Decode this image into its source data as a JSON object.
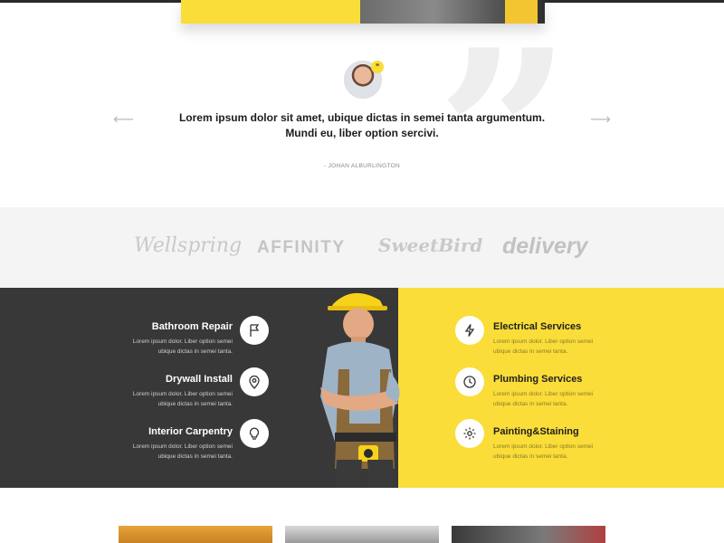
{
  "testimonial": {
    "quote": "Lorem ipsum dolor sit amet, ubique dictas in semei tanta argumentum. Mundi eu, liber option sercivi.",
    "author": "- JOHAN ALBURLINGTON",
    "prev_arrow": "⟵",
    "next_arrow": "⟶",
    "badge": "”"
  },
  "logos": [
    "Wellspring",
    "AFFINITY",
    "SweetBird",
    "delivery"
  ],
  "services": {
    "left": [
      {
        "title": "Bathroom Repair",
        "desc_line1": "Lorem ipsum dolor. Liber option semei",
        "desc_line2": "ubique dictas in semei tanta.",
        "icon": "flag-icon"
      },
      {
        "title": "Drywall Install",
        "desc_line1": "Lorem ipsum dolor. Liber option semei",
        "desc_line2": "ubique dictas in semei tanta.",
        "icon": "map-pin-icon"
      },
      {
        "title": "Interior Carpentry",
        "desc_line1": "Lorem ipsum dolor. Liber option semei",
        "desc_line2": "ubique dictas in semei tanta.",
        "icon": "lightbulb-icon"
      }
    ],
    "right": [
      {
        "title": "Electrical Services",
        "desc_line1": "Lorem ipsum dolor. Liber option semei",
        "desc_line2": "ubique dictas in semei tanta.",
        "icon": "lightning-icon"
      },
      {
        "title": "Plumbing Services",
        "desc_line1": "Lorem ipsum dolor. Liber option semei",
        "desc_line2": "ubique dictas in semei tanta.",
        "icon": "clock-icon"
      },
      {
        "title": "Painting&Staining",
        "desc_line1": "Lorem ipsum dolor. Liber option semei",
        "desc_line2": "ubique dictas in semei tanta.",
        "icon": "gear-icon"
      }
    ]
  },
  "colors": {
    "accent_yellow": "#fadd38",
    "dark_panel": "#383838",
    "logo_gray": "#c9c9c9"
  }
}
